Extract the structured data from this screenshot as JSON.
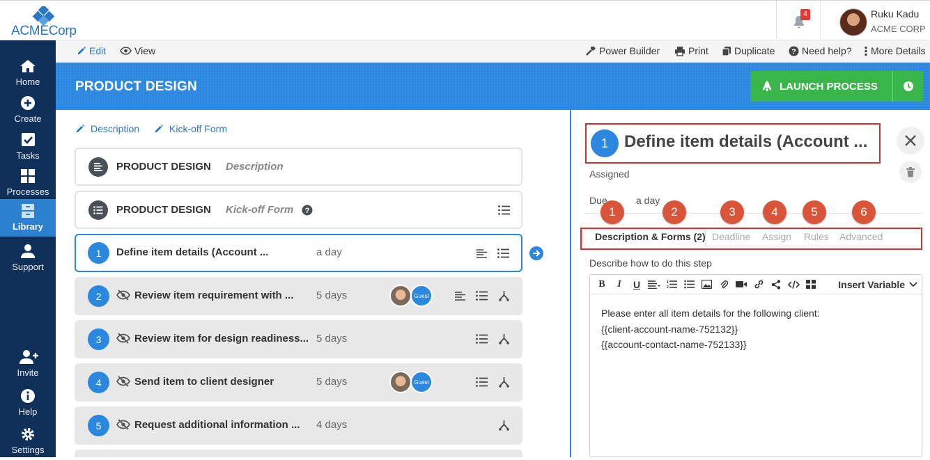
{
  "brand": {
    "name_part1": "ACME",
    "name_part2": "Corp",
    "accent": "#2b88de",
    "navy": "#0f3058",
    "success": "#3ab54a",
    "alert": "#d32f2f"
  },
  "notifications": {
    "count": "4"
  },
  "user": {
    "name": "Ruku Kadu",
    "org": "ACME CORP"
  },
  "sidebar": {
    "items": [
      {
        "label": "Home",
        "icon": "home-icon"
      },
      {
        "label": "Create",
        "icon": "plus-circle-icon"
      },
      {
        "label": "Tasks",
        "icon": "check-square-icon"
      },
      {
        "label": "Processes",
        "icon": "grid-icon"
      },
      {
        "label": "Library",
        "icon": "library-icon",
        "active": true
      },
      {
        "label": "Support",
        "icon": "user-icon"
      },
      {
        "label": "Invite",
        "icon": "user-plus-icon"
      },
      {
        "label": "Help",
        "icon": "info-icon"
      },
      {
        "label": "Settings",
        "icon": "gear-icon"
      }
    ]
  },
  "toolbar": {
    "edit": "Edit",
    "view": "View",
    "power_builder": "Power Builder",
    "print": "Print",
    "duplicate": "Duplicate",
    "need_help": "Need help?",
    "more_details": "More Details"
  },
  "header": {
    "title": "PRODUCT DESIGN",
    "launch_label": "LAUNCH PROCESS"
  },
  "left": {
    "links": {
      "description": "Description",
      "kickoff": "Kick-off Form"
    },
    "cards": [
      {
        "title": "PRODUCT DESIGN",
        "subtitle": "Description"
      },
      {
        "title": "PRODUCT DESIGN",
        "subtitle": "Kick-off Form"
      }
    ],
    "steps": [
      {
        "num": "1",
        "name": "Define item details (Account ...",
        "duration": "a day"
      },
      {
        "num": "2",
        "name": "Review item requirement with ...",
        "duration": "5 days",
        "guest": "Guest"
      },
      {
        "num": "3",
        "name": "Review item for design readiness...",
        "duration": "5 days"
      },
      {
        "num": "4",
        "name": "Send item to client designer",
        "duration": "5 days",
        "guest": "Guest"
      },
      {
        "num": "5",
        "name": "Request additional information ...",
        "duration": "4 days"
      }
    ]
  },
  "panel": {
    "step_num": "1",
    "title": "Define item details (Account ...",
    "assigned_label": "Assigned",
    "due_label": "Due",
    "due_value": "a day",
    "markers": [
      "1",
      "2",
      "3",
      "4",
      "5",
      "6"
    ],
    "tabs": [
      "Description & Forms (2)",
      "Deadline",
      "Assign",
      "Rules",
      "Advanced"
    ],
    "describe_label": "Describe how to do this step",
    "insert_variable": "Insert Variable",
    "body_lines": [
      "Please enter all item details for the following client:",
      "{{client-account-name-752132}}",
      "{{account-contact-name-752133}}"
    ]
  }
}
